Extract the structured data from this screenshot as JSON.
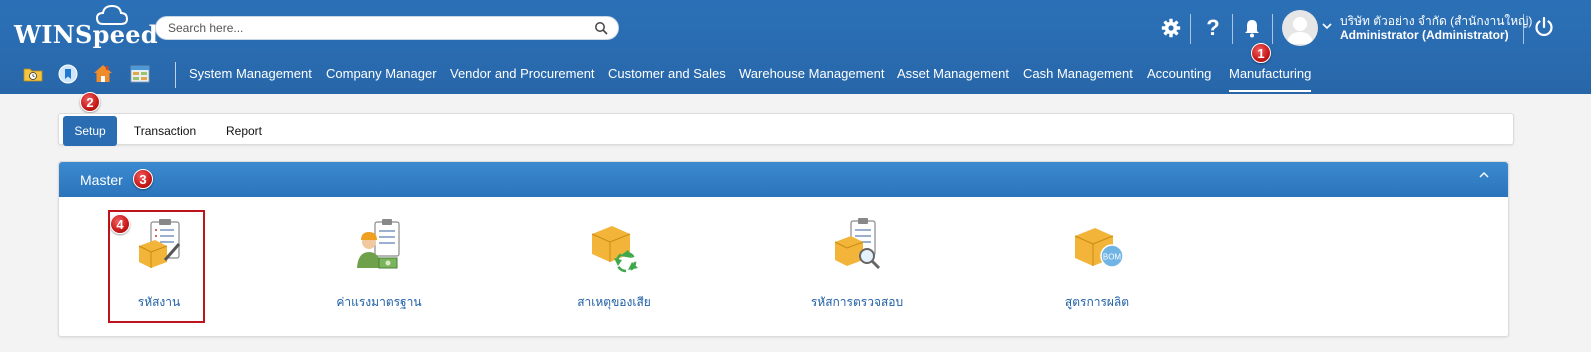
{
  "app": {
    "logo_text": "WINSpeed"
  },
  "search": {
    "placeholder": "Search here..."
  },
  "user": {
    "company": "บริษัท ตัวอย่าง จำกัด (สำนักงานใหญ่)",
    "role": "Administrator (Administrator)"
  },
  "modules": [
    {
      "label": "System Management"
    },
    {
      "label": "Company Manager"
    },
    {
      "label": "Vendor and Procurement"
    },
    {
      "label": "Customer and Sales"
    },
    {
      "label": "Warehouse Management"
    },
    {
      "label": "Asset Management"
    },
    {
      "label": "Cash Management"
    },
    {
      "label": "Accounting"
    },
    {
      "label": "Manufacturing",
      "active": true
    }
  ],
  "tabs": [
    {
      "label": "Setup",
      "active": true
    },
    {
      "label": "Transaction"
    },
    {
      "label": "Report"
    }
  ],
  "panel": {
    "title": "Master",
    "items": [
      {
        "label": "รหัสงาน",
        "icon": "job-code-icon"
      },
      {
        "label": "ค่าแรงมาตรฐาน",
        "icon": "standard-labor-icon"
      },
      {
        "label": "สาเหตุของเสีย",
        "icon": "waste-reason-icon"
      },
      {
        "label": "รหัสการตรวจสอบ",
        "icon": "inspection-code-icon"
      },
      {
        "label": "สูตรการผลิต",
        "icon": "bom-icon",
        "badge_text": "BOM"
      }
    ]
  },
  "step_badges": [
    "1",
    "2",
    "3",
    "4"
  ],
  "colors": {
    "header_blue": "#2a6bb0",
    "accent_blue": "#2a6db3",
    "badge_red": "#c81818",
    "highlight_red": "#c0141c",
    "link_blue": "#1f5fa5"
  }
}
